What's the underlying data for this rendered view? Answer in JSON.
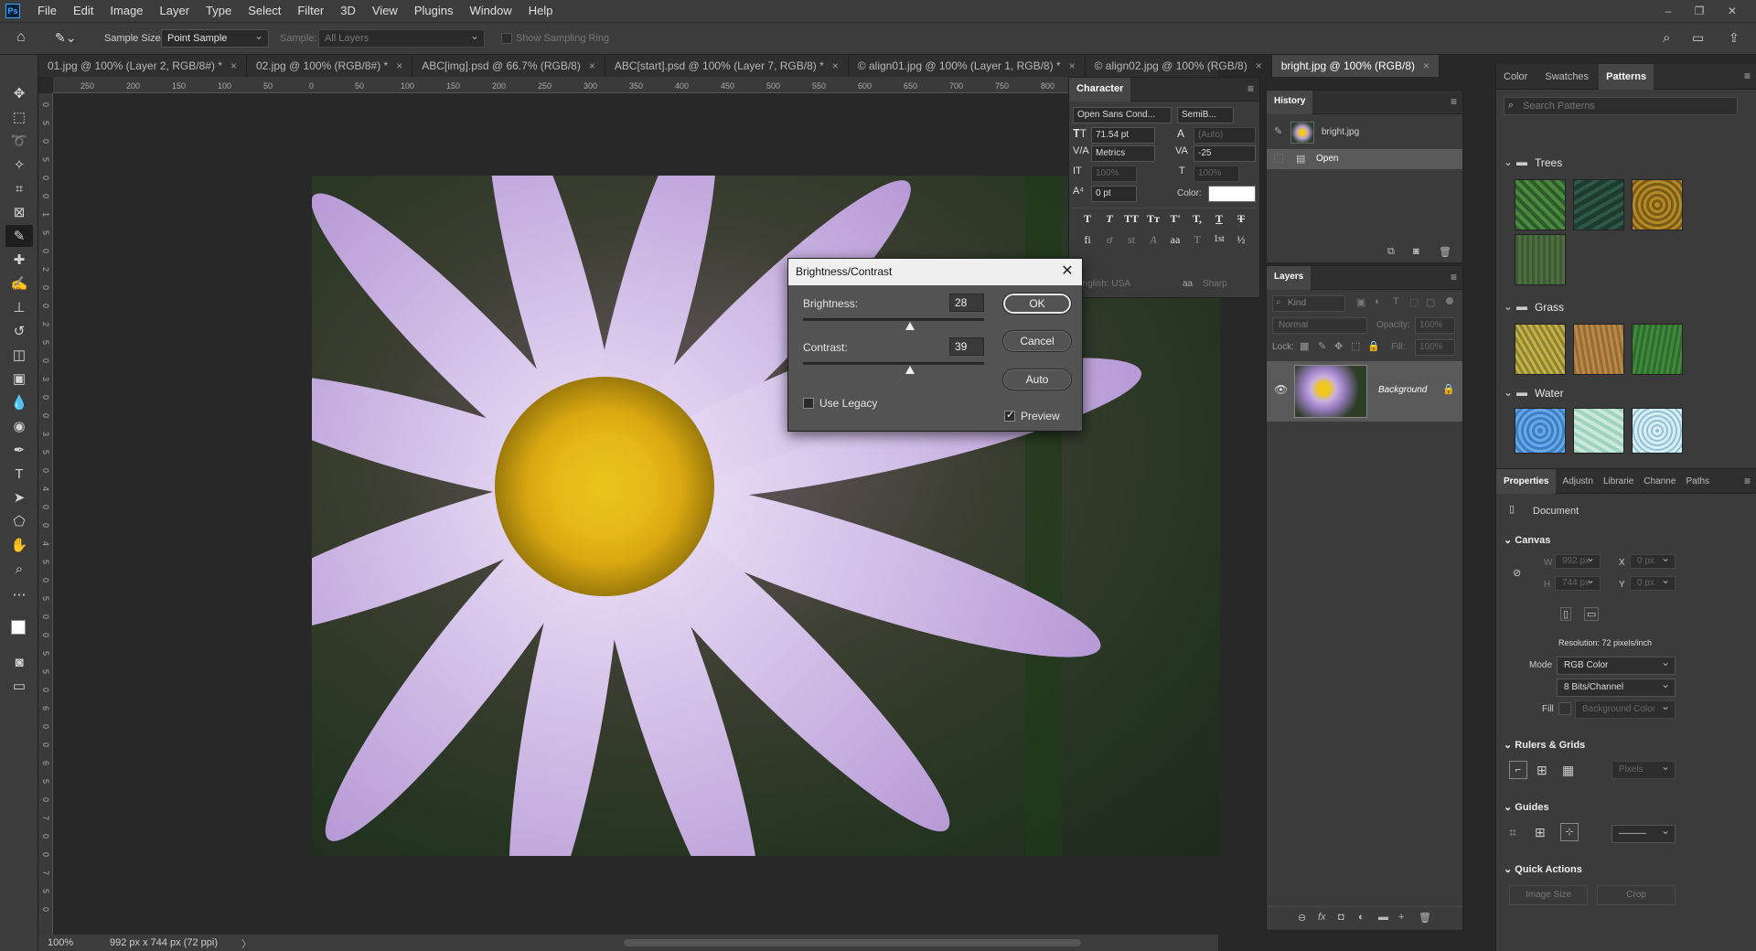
{
  "app": {
    "logo": "Ps"
  },
  "menu": [
    "File",
    "Edit",
    "Image",
    "Layer",
    "Type",
    "Select",
    "Filter",
    "3D",
    "View",
    "Plugins",
    "Window",
    "Help"
  ],
  "window_controls": {
    "minimize": "–",
    "restore": "❐",
    "close": "✕"
  },
  "options_bar": {
    "sample_size_label": "Sample Size:",
    "sample_size_value": "Point Sample",
    "sample_label": "Sample:",
    "sample_value": "All Layers",
    "sampling_ring_label": "Show Sampling Ring"
  },
  "doc_tabs": [
    {
      "label": "01.jpg @ 100% (Layer 2, RGB/8#) *"
    },
    {
      "label": "02.jpg @ 100% (RGB/8#) *"
    },
    {
      "label": "ABC[img].psd @ 66.7% (RGB/8)"
    },
    {
      "label": "ABC[start].psd @ 100% (Layer 7, RGB/8) *"
    },
    {
      "label": "© align01.jpg @ 100% (Layer 1, RGB/8) *"
    },
    {
      "label": "© align02.jpg @ 100% (RGB/8)"
    },
    {
      "label": "bright.jpg @ 100% (RGB/8)"
    }
  ],
  "tab_close": "×",
  "ruler_h": [
    "250",
    "200",
    "150",
    "100",
    "50",
    "0",
    "50",
    "100",
    "150",
    "200",
    "250",
    "300",
    "350",
    "400",
    "450",
    "500",
    "550",
    "600",
    "650",
    "700",
    "750",
    "800"
  ],
  "ruler_v": [
    "0",
    "5",
    "0",
    "5",
    "0",
    "0",
    "1",
    "5",
    "0",
    "2",
    "0",
    "0",
    "2",
    "5",
    "0",
    "3",
    "0",
    "0",
    "3",
    "5",
    "0",
    "4",
    "0",
    "0",
    "4",
    "5",
    "0",
    "5",
    "0",
    "0",
    "5",
    "5",
    "0",
    "6",
    "0",
    "0",
    "6",
    "5",
    "0",
    "7",
    "0",
    "0",
    "7",
    "5",
    "0"
  ],
  "status": {
    "zoom": "100%",
    "doc_info": "992 px x 744 px (72 ppi)",
    "arrow": "〉"
  },
  "character": {
    "tab": "Character",
    "font_family": "Open Sans Cond...",
    "font_style": "SemiB...",
    "font_size": "71.54 pt",
    "leading": "(Auto)",
    "kerning": "Metrics",
    "tracking": "-25",
    "vscale": "100%",
    "hscale": "100%",
    "baseline": "0 pt",
    "color_label": "Color:",
    "language": "English: USA",
    "antialias": "Sharp",
    "aa_icon": "aa",
    "type_buttons": [
      "T",
      "T",
      "TT",
      "Tт",
      "T'",
      "T,",
      "T",
      "T"
    ],
    "opentype_buttons": [
      "fi",
      "ơ",
      "st",
      "A",
      "aa",
      "T",
      "1st",
      "½"
    ]
  },
  "history": {
    "tab": "History",
    "snapshot": "bright.jpg",
    "items": [
      {
        "label": "Open"
      }
    ]
  },
  "layers": {
    "tab": "Layers",
    "kind_filter": "Kind",
    "blend_mode": "Normal",
    "opacity_label": "Opacity:",
    "opacity": "100%",
    "lock_label": "Lock:",
    "fill_label": "Fill:",
    "fill": "100%",
    "items": [
      {
        "name": "Background"
      }
    ],
    "footer_icons": [
      "⊖",
      "fx",
      "◘",
      "◐",
      "▬",
      "+",
      "🗑"
    ]
  },
  "right_panel": {
    "tabs": [
      "Color",
      "Swatches",
      "Patterns"
    ],
    "search_placeholder": "Search Patterns",
    "groups": [
      {
        "name": "Trees"
      },
      {
        "name": "Grass"
      },
      {
        "name": "Water"
      }
    ],
    "colors": {
      "trees": [
        "#2f5a2e",
        "#1e3b31",
        "#b48a26",
        "#3d5a32"
      ],
      "grass": [
        "#8b8432",
        "#9a6a32",
        "#2e6b2d"
      ],
      "water": [
        "#3b7fc6",
        "#9fd2c0",
        "#8fc3d5"
      ]
    }
  },
  "properties": {
    "tabs": [
      "Properties",
      "Adjustn",
      "Librarie",
      "Channe",
      "Paths"
    ],
    "doc_label": "Document",
    "canvas_head": "Canvas",
    "w_label": "W",
    "w": "992 px",
    "h_label": "H",
    "h": "744 px",
    "x_label": "X",
    "x": "0 px",
    "y_label": "Y",
    "y": "0 px",
    "resolution": "Resolution: 72 pixels/inch",
    "mode_label": "Mode",
    "mode": "RGB Color",
    "bits": "8 Bits/Channel",
    "fill_label": "Fill",
    "fill": "Background Color",
    "rulers_head": "Rulers & Grids",
    "units": "Pixels",
    "guides_head": "Guides",
    "guide_line": "———",
    "quick_head": "Quick Actions",
    "image_size_btn": "Image Size",
    "crop_btn": "Crop"
  },
  "dialog": {
    "title": "Brightness/Contrast",
    "close": "✕",
    "brightness_label": "Brightness:",
    "brightness": "28",
    "brightness_level": 28,
    "contrast_label": "Contrast:",
    "contrast": "39",
    "contrast_level": 39,
    "ok": "OK",
    "cancel": "Cancel",
    "auto": "Auto",
    "legacy_label": "Use Legacy",
    "use_legacy": false,
    "preview_label": "Preview",
    "preview": true
  }
}
